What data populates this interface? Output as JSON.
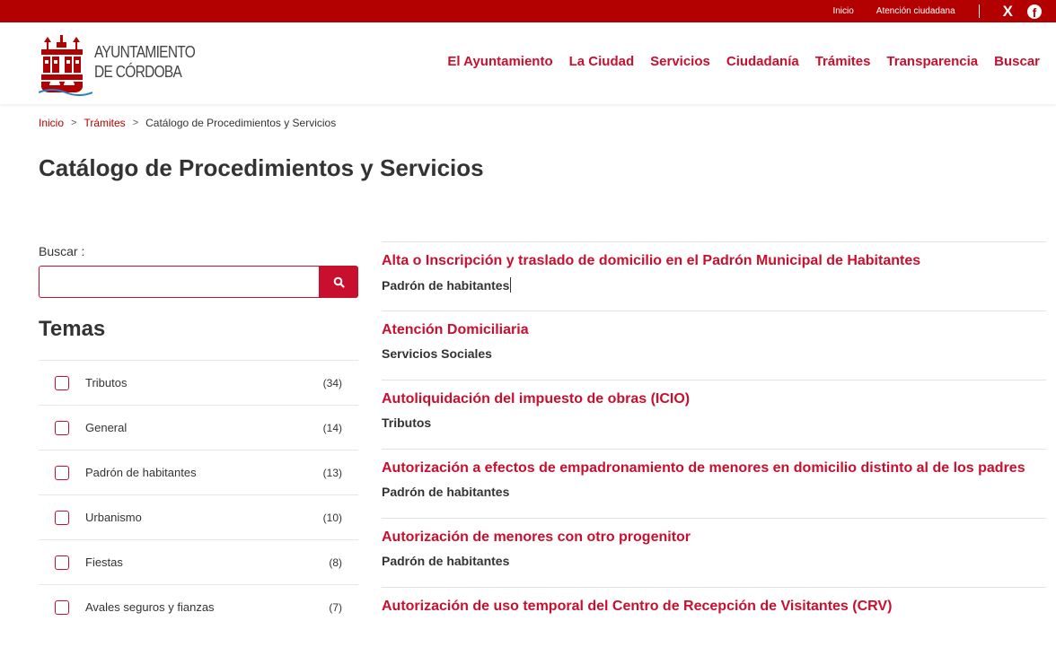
{
  "topbar": {
    "inicio": "Inicio",
    "atencion": "Atención ciudadana",
    "x_glyph": "X",
    "facebook_glyph": "f"
  },
  "logo": {
    "line1": "AYUNTAMIENTO",
    "line2": "DE CÓRDOBA"
  },
  "nav": {
    "items": [
      "El Ayuntamiento",
      "La Ciudad",
      "Servicios",
      "Ciudadanía",
      "Trámites",
      "Transparencia",
      "Buscar"
    ]
  },
  "breadcrumb": {
    "home": "Inicio",
    "tramites": "Trámites",
    "current": "Catálogo de Procedimientos y Servicios",
    "separator": ">"
  },
  "page": {
    "title": "Catálogo de Procedimientos y Servicios"
  },
  "search": {
    "label": "Buscar :",
    "value": "",
    "icon": "search-icon"
  },
  "temas": {
    "title": "Temas",
    "items": [
      {
        "label": "Tributos",
        "count": "(34)"
      },
      {
        "label": "General",
        "count": "(14)"
      },
      {
        "label": "Padrón de habitantes",
        "count": "(13)"
      },
      {
        "label": "Urbanismo",
        "count": "(10)"
      },
      {
        "label": "Fiestas",
        "count": "(8)"
      },
      {
        "label": "Avales seguros y fianzas",
        "count": "(7)"
      }
    ]
  },
  "results": [
    {
      "title": "Alta o Inscripción y traslado de domicilio en el Padrón Municipal de Habitantes",
      "category": "Padrón de habitantes"
    },
    {
      "title": "Atención Domiciliaria",
      "category": "Servicios Sociales"
    },
    {
      "title": "Autoliquidación del impuesto de obras (ICIO)",
      "category": "Tributos"
    },
    {
      "title": "Autorización a efectos de empadronamiento de menores en domicilio distinto al de los padres",
      "category": "Padrón de habitantes"
    },
    {
      "title": "Autorización de menores con otro progenitor",
      "category": "Padrón de habitantes"
    },
    {
      "title": "Autorización de uso temporal del Centro de Recepción de Visitantes (CRV)",
      "category": ""
    }
  ],
  "colors": {
    "brand": "#b30000",
    "accent": "#c8102e",
    "text": "#333333"
  }
}
